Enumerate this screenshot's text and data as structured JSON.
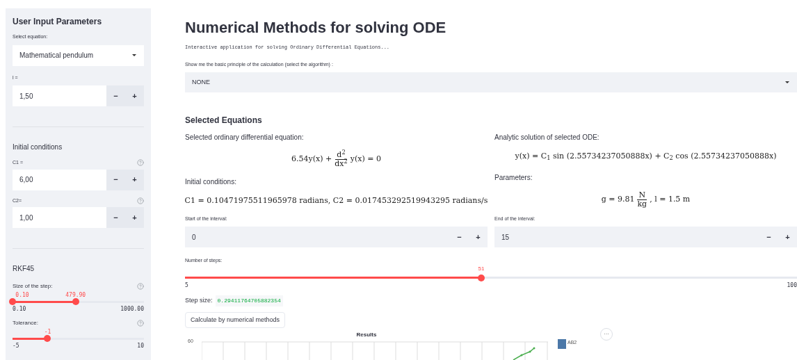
{
  "sidebar": {
    "title": "User Input Parameters",
    "equation_select": {
      "label": "Select equation:",
      "value": "Mathematical pendulum"
    },
    "length_field": {
      "label": "l =",
      "value": "1,50",
      "decrement": "−",
      "increment": "+",
      "help": false
    },
    "initial_heading": "Initial conditions",
    "initial_fields": [
      {
        "label": "C1 =",
        "value": "6,00",
        "decrement": "−",
        "increment": "+",
        "help": true
      },
      {
        "label": "C2=",
        "value": "1,00",
        "decrement": "−",
        "increment": "+",
        "help": true
      }
    ],
    "method_heading": "RKF45",
    "sliders": [
      {
        "kind": "range",
        "label": "Size of the step:",
        "help": true,
        "thumbs": [
          {
            "reading": "0.10",
            "level": 0
          },
          {
            "reading": "479.90",
            "level": 0.48
          }
        ],
        "min": "0.10",
        "max": "1000.00"
      },
      {
        "kind": "single",
        "label": "Tolerance:",
        "help": true,
        "thumbs": [
          {
            "reading": "-1",
            "level": 0.267
          }
        ],
        "min": "-5",
        "max": "10"
      }
    ]
  },
  "main": {
    "title": "Numerical Methods for solving ODE",
    "subtitle": "Interactive application for solving Ordinary Differential Equations...",
    "algorithm_select": {
      "label": "Show me the basic principle of the calculation (select the algorithm) :",
      "value": "NONE"
    },
    "section_title": "Selected Equations",
    "left": [
      {
        "kind": "label",
        "text": "Selected ordinary differential equation:"
      },
      {
        "kind": "fraction",
        "before": "6.54y(x) +",
        "num": "d$^{2}$",
        "den": "dx$^{2}$",
        "after": "y(x) = 0"
      },
      {
        "kind": "label",
        "text": "Initial conditions:"
      },
      {
        "kind": "formula",
        "text": "C1 = 0.10471975511965978 radians, C2 = 0.017453292519943295 radians/s"
      }
    ],
    "right": [
      {
        "kind": "label",
        "text": "Analytic solution of selected ODE:"
      },
      {
        "kind": "formula",
        "text": "y(x) = C$_{1}$ sin (2.55734237050888x) + C$_{2}$ cos (2.55734237050888x)"
      },
      {
        "kind": "label",
        "text": "Parameters:"
      },
      {
        "kind": "fraction",
        "before": "g = 9.81",
        "num": "N",
        "den": "kg",
        "after": ", l = 1.5 m"
      }
    ],
    "interval_fields": [
      {
        "label": "Start of the interval:",
        "value": "0",
        "decrement": "−",
        "increment": "+"
      },
      {
        "label": "End of the interval:",
        "value": "15",
        "decrement": "−",
        "increment": "+"
      }
    ],
    "steps_slider": {
      "label": "Number of steps:",
      "reading": "51",
      "level": 0.484,
      "min": "5",
      "max": "100"
    },
    "step_size": {
      "label": "Step size:",
      "value": "0.29411764705882354"
    },
    "calculate_button": "Calculate by numerical methods",
    "chart": {
      "title": "Results",
      "ytick": "60",
      "legend": "AB2",
      "menu": "···"
    }
  }
}
